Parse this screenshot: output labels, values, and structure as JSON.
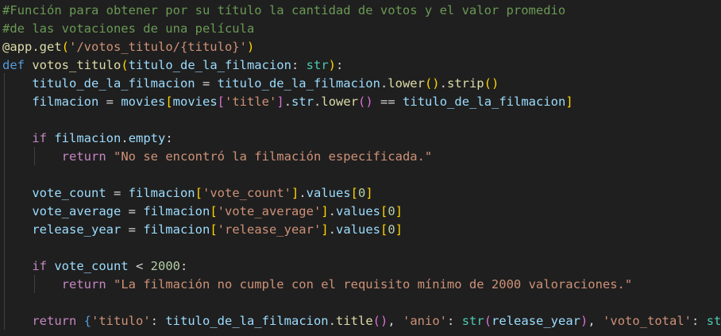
{
  "editor": {
    "language": "python",
    "colors": {
      "background": "#1f1f1f",
      "comment": "#6a9955",
      "keyword": "#569cd6",
      "control": "#c586c0",
      "function": "#dcdcaa",
      "variable": "#9cdcfe",
      "string": "#ce9178",
      "number": "#b5cea8",
      "type": "#4ec9b0"
    },
    "lines": [
      {
        "tokens": [
          {
            "t": "comment",
            "v": "#Función para obtener por su título la cantidad de votos y el valor promedio"
          }
        ]
      },
      {
        "tokens": [
          {
            "t": "comment",
            "v": "#de las votaciones de una película"
          }
        ]
      },
      {
        "tokens": [
          {
            "t": "deco",
            "v": "@app.get"
          },
          {
            "t": "br1",
            "v": "("
          },
          {
            "t": "str",
            "v": "'/votos_titulo/{titulo}'"
          },
          {
            "t": "br1",
            "v": ")"
          }
        ]
      },
      {
        "tokens": [
          {
            "t": "keyword",
            "v": "def"
          },
          {
            "t": "plain",
            "v": " "
          },
          {
            "t": "func",
            "v": "votos_titulo"
          },
          {
            "t": "br1",
            "v": "("
          },
          {
            "t": "var",
            "v": "titulo_de_la_filmacion"
          },
          {
            "t": "plain",
            "v": ": "
          },
          {
            "t": "type",
            "v": "str"
          },
          {
            "t": "br1",
            "v": ")"
          },
          {
            "t": "plain",
            "v": ":"
          }
        ]
      },
      {
        "tokens": [
          {
            "t": "plain",
            "v": "    "
          },
          {
            "t": "var",
            "v": "titulo_de_la_filmacion"
          },
          {
            "t": "plain",
            "v": " = "
          },
          {
            "t": "var",
            "v": "titulo_de_la_filmacion"
          },
          {
            "t": "plain",
            "v": "."
          },
          {
            "t": "func",
            "v": "lower"
          },
          {
            "t": "br1",
            "v": "()"
          },
          {
            "t": "plain",
            "v": "."
          },
          {
            "t": "func",
            "v": "strip"
          },
          {
            "t": "br1",
            "v": "()"
          }
        ]
      },
      {
        "tokens": [
          {
            "t": "plain",
            "v": "    "
          },
          {
            "t": "var",
            "v": "filmacion"
          },
          {
            "t": "plain",
            "v": " = "
          },
          {
            "t": "var",
            "v": "movies"
          },
          {
            "t": "br1",
            "v": "["
          },
          {
            "t": "var",
            "v": "movies"
          },
          {
            "t": "br2",
            "v": "["
          },
          {
            "t": "str",
            "v": "'title'"
          },
          {
            "t": "br2",
            "v": "]"
          },
          {
            "t": "plain",
            "v": "."
          },
          {
            "t": "var",
            "v": "str"
          },
          {
            "t": "plain",
            "v": "."
          },
          {
            "t": "func",
            "v": "lower"
          },
          {
            "t": "br2",
            "v": "()"
          },
          {
            "t": "plain",
            "v": " == "
          },
          {
            "t": "var",
            "v": "titulo_de_la_filmacion"
          },
          {
            "t": "br1",
            "v": "]"
          }
        ]
      },
      {
        "tokens": []
      },
      {
        "tokens": [
          {
            "t": "plain",
            "v": "    "
          },
          {
            "t": "control",
            "v": "if"
          },
          {
            "t": "plain",
            "v": " "
          },
          {
            "t": "var",
            "v": "filmacion"
          },
          {
            "t": "plain",
            "v": "."
          },
          {
            "t": "var",
            "v": "empty"
          },
          {
            "t": "plain",
            "v": ":"
          }
        ]
      },
      {
        "tokens": [
          {
            "t": "plain",
            "v": "        "
          },
          {
            "t": "control",
            "v": "return"
          },
          {
            "t": "plain",
            "v": " "
          },
          {
            "t": "str",
            "v": "\"No se encontró la filmación especificada.\""
          }
        ]
      },
      {
        "tokens": []
      },
      {
        "tokens": [
          {
            "t": "plain",
            "v": "    "
          },
          {
            "t": "var",
            "v": "vote_count"
          },
          {
            "t": "plain",
            "v": " = "
          },
          {
            "t": "var",
            "v": "filmacion"
          },
          {
            "t": "br1",
            "v": "["
          },
          {
            "t": "str",
            "v": "'vote_count'"
          },
          {
            "t": "br1",
            "v": "]"
          },
          {
            "t": "plain",
            "v": "."
          },
          {
            "t": "var",
            "v": "values"
          },
          {
            "t": "br1",
            "v": "["
          },
          {
            "t": "num",
            "v": "0"
          },
          {
            "t": "br1",
            "v": "]"
          }
        ]
      },
      {
        "tokens": [
          {
            "t": "plain",
            "v": "    "
          },
          {
            "t": "var",
            "v": "vote_average"
          },
          {
            "t": "plain",
            "v": " = "
          },
          {
            "t": "var",
            "v": "filmacion"
          },
          {
            "t": "br1",
            "v": "["
          },
          {
            "t": "str",
            "v": "'vote_average'"
          },
          {
            "t": "br1",
            "v": "]"
          },
          {
            "t": "plain",
            "v": "."
          },
          {
            "t": "var",
            "v": "values"
          },
          {
            "t": "br1",
            "v": "["
          },
          {
            "t": "num",
            "v": "0"
          },
          {
            "t": "br1",
            "v": "]"
          }
        ]
      },
      {
        "tokens": [
          {
            "t": "plain",
            "v": "    "
          },
          {
            "t": "var",
            "v": "release_year"
          },
          {
            "t": "plain",
            "v": " = "
          },
          {
            "t": "var",
            "v": "filmacion"
          },
          {
            "t": "br1",
            "v": "["
          },
          {
            "t": "str",
            "v": "'release_year'"
          },
          {
            "t": "br1",
            "v": "]"
          },
          {
            "t": "plain",
            "v": "."
          },
          {
            "t": "var",
            "v": "values"
          },
          {
            "t": "br1",
            "v": "["
          },
          {
            "t": "num",
            "v": "0"
          },
          {
            "t": "br1",
            "v": "]"
          }
        ]
      },
      {
        "tokens": []
      },
      {
        "tokens": [
          {
            "t": "plain",
            "v": "    "
          },
          {
            "t": "control",
            "v": "if"
          },
          {
            "t": "plain",
            "v": " "
          },
          {
            "t": "var",
            "v": "vote_count"
          },
          {
            "t": "plain",
            "v": " < "
          },
          {
            "t": "num",
            "v": "2000"
          },
          {
            "t": "plain",
            "v": ":"
          }
        ]
      },
      {
        "tokens": [
          {
            "t": "plain",
            "v": "        "
          },
          {
            "t": "control",
            "v": "return"
          },
          {
            "t": "plain",
            "v": " "
          },
          {
            "t": "str",
            "v": "\"La filmación no cumple con el requisito mínimo de 2000 valoraciones.\""
          }
        ]
      },
      {
        "tokens": []
      },
      {
        "tokens": [
          {
            "t": "plain",
            "v": "    "
          },
          {
            "t": "control",
            "v": "return"
          },
          {
            "t": "plain",
            "v": " "
          },
          {
            "t": "brace",
            "v": "{"
          },
          {
            "t": "str",
            "v": "'titulo'"
          },
          {
            "t": "plain",
            "v": ": "
          },
          {
            "t": "var",
            "v": "titulo_de_la_filmacion"
          },
          {
            "t": "plain",
            "v": "."
          },
          {
            "t": "func",
            "v": "title"
          },
          {
            "t": "br2",
            "v": "()"
          },
          {
            "t": "plain",
            "v": ", "
          },
          {
            "t": "str",
            "v": "'anio'"
          },
          {
            "t": "plain",
            "v": ": "
          },
          {
            "t": "type",
            "v": "str"
          },
          {
            "t": "br2",
            "v": "("
          },
          {
            "t": "var",
            "v": "release_year"
          },
          {
            "t": "br2",
            "v": ")"
          },
          {
            "t": "plain",
            "v": ", "
          },
          {
            "t": "str",
            "v": "'voto_total'"
          },
          {
            "t": "plain",
            "v": ": "
          },
          {
            "t": "type",
            "v": "str"
          }
        ]
      }
    ]
  }
}
